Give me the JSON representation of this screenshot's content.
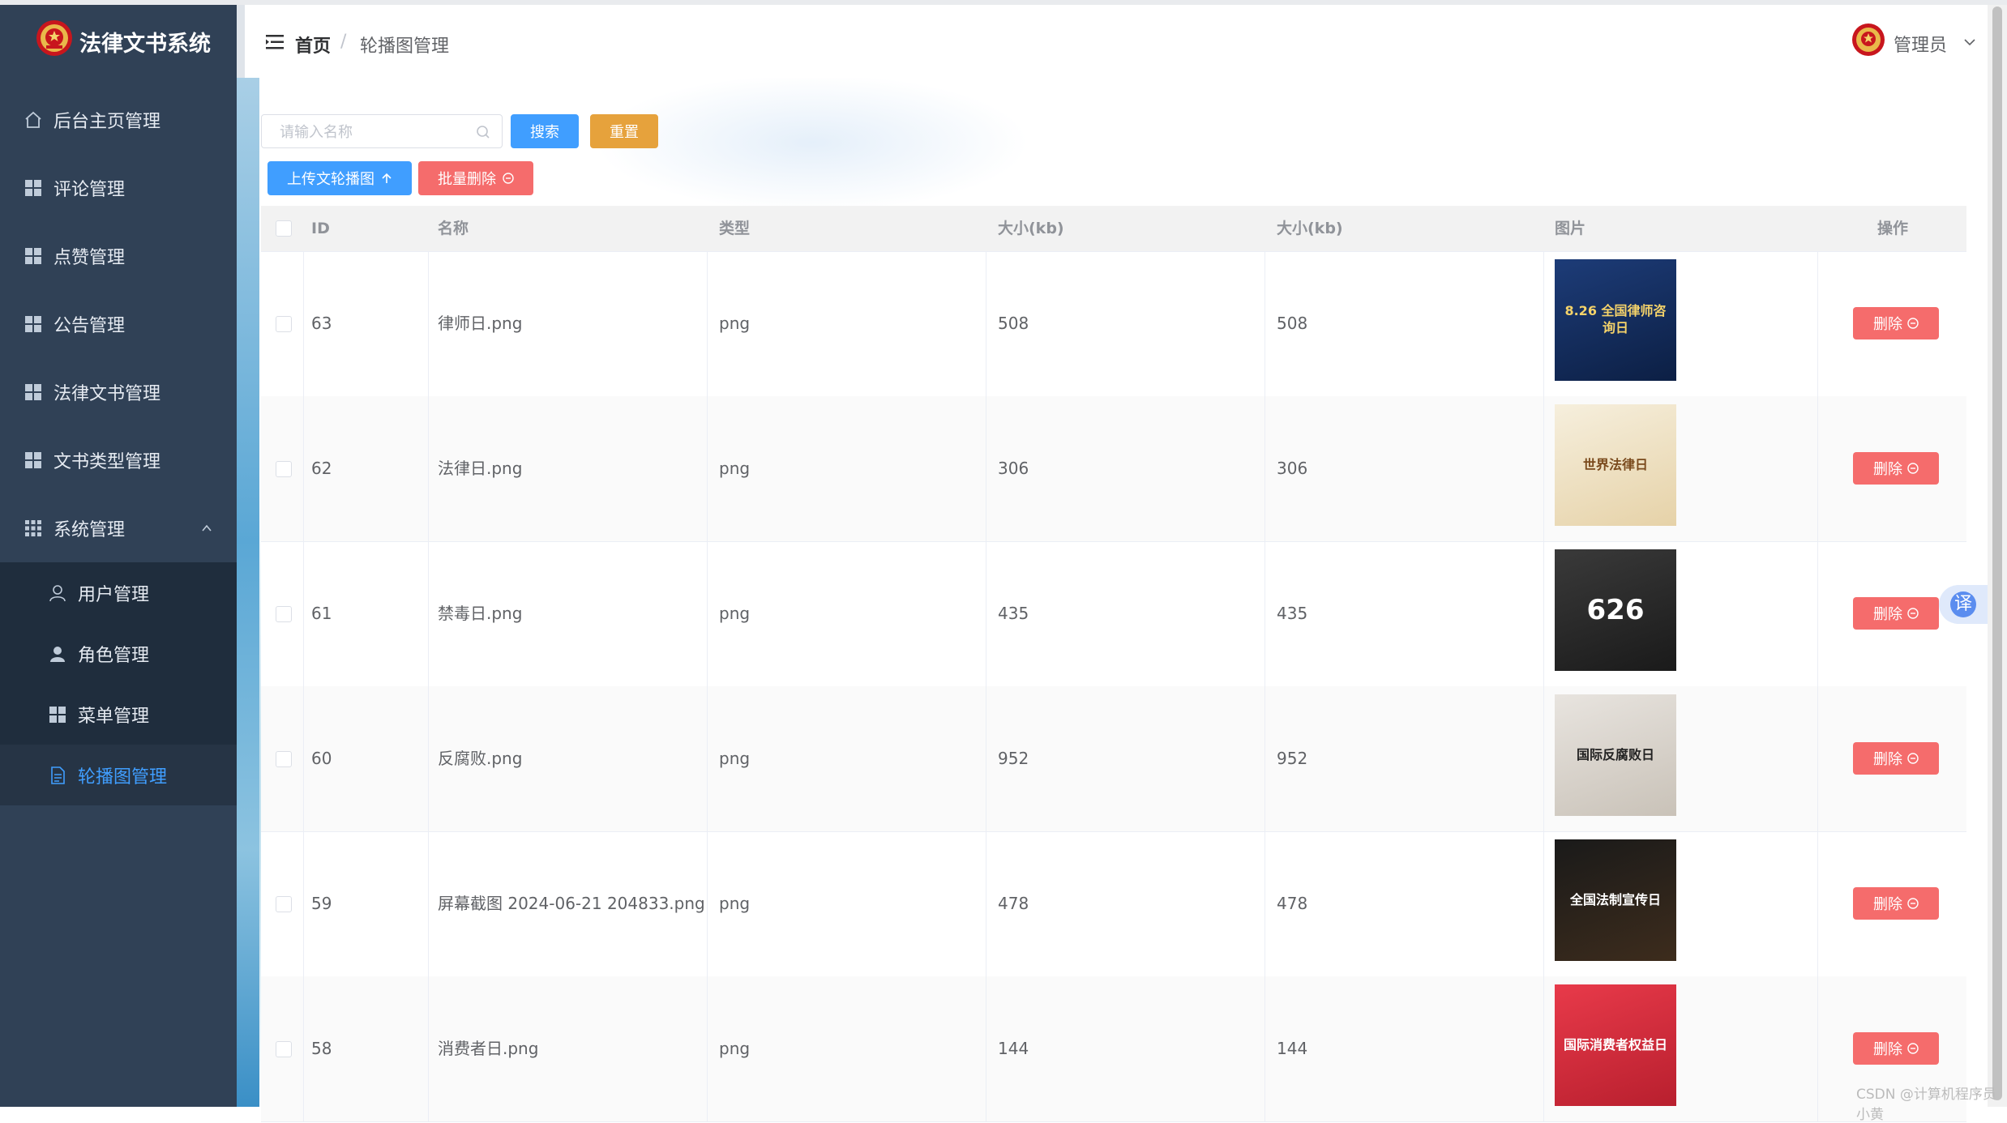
{
  "app": {
    "title": "法律文书系统"
  },
  "sidebar": {
    "items": [
      {
        "label": "后台主页管理",
        "icon": "home-icon"
      },
      {
        "label": "评论管理",
        "icon": "grid-icon"
      },
      {
        "label": "点赞管理",
        "icon": "grid-icon"
      },
      {
        "label": "公告管理",
        "icon": "grid-icon"
      },
      {
        "label": "法律文书管理",
        "icon": "grid-icon"
      },
      {
        "label": "文书类型管理",
        "icon": "grid-icon"
      },
      {
        "label": "系统管理",
        "icon": "grid-icon",
        "expanded": true
      }
    ],
    "subitems": [
      {
        "label": "用户管理",
        "icon": "user-outline-icon"
      },
      {
        "label": "角色管理",
        "icon": "user-solid-icon"
      },
      {
        "label": "菜单管理",
        "icon": "grid-icon"
      },
      {
        "label": "轮播图管理",
        "icon": "document-icon",
        "active": true
      }
    ]
  },
  "header": {
    "breadcrumb_home": "首页",
    "breadcrumb_sep": "/",
    "breadcrumb_current": "轮播图管理",
    "user_name": "管理员"
  },
  "toolbar": {
    "search_placeholder": "请输入名称",
    "search_value": "",
    "search_label": "搜索",
    "reset_label": "重置",
    "upload_label": "上传文轮播图",
    "batch_delete_label": "批量删除"
  },
  "table": {
    "headers": [
      "ID",
      "名称",
      "类型",
      "大小(kb)",
      "大小(kb)",
      "图片",
      "操作"
    ],
    "delete_label": "删除",
    "rows": [
      {
        "id": "63",
        "name": "律师日.png",
        "type": "png",
        "size1": "508",
        "size2": "508",
        "image_text": "8.26 全国律师咨询日"
      },
      {
        "id": "62",
        "name": "法律日.png",
        "type": "png",
        "size1": "306",
        "size2": "306",
        "image_text": "世界法律日"
      },
      {
        "id": "61",
        "name": "禁毒日.png",
        "type": "png",
        "size1": "435",
        "size2": "435",
        "image_text": "626"
      },
      {
        "id": "60",
        "name": "反腐败.png",
        "type": "png",
        "size1": "952",
        "size2": "952",
        "image_text": "国际反腐败日"
      },
      {
        "id": "59",
        "name": "屏幕截图 2024-06-21 204833.png",
        "type": "png",
        "size1": "478",
        "size2": "478",
        "image_text": "全国法制宣传日"
      },
      {
        "id": "58",
        "name": "消费者日.png",
        "type": "png",
        "size1": "144",
        "size2": "144",
        "image_text": "国际消费者权益日"
      }
    ]
  },
  "widgets": {
    "translate_label": "译",
    "watermark": "CSDN @计算机程序员小黄"
  },
  "colors": {
    "sidebar_bg": "#304156",
    "primary": "#409eff",
    "warning": "#e6a23c",
    "danger": "#f56c6c",
    "active_text": "#409eff"
  }
}
